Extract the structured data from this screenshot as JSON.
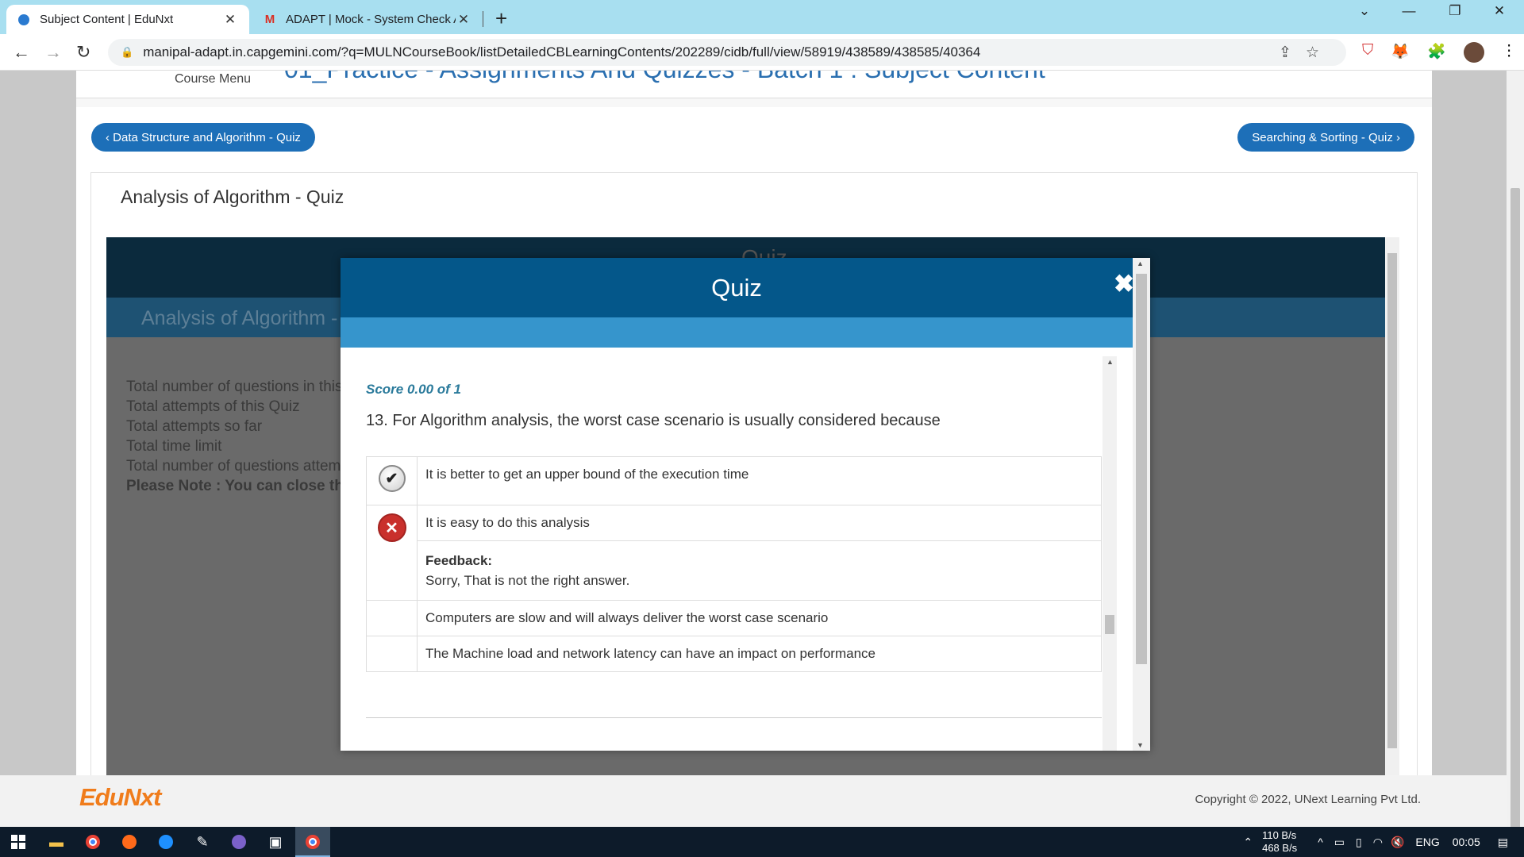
{
  "browser": {
    "tabs": [
      {
        "title": "Subject Content | EduNxt",
        "active": true
      },
      {
        "title": "ADAPT | Mock - System Check As",
        "active": false
      }
    ],
    "url": "manipal-adapt.in.capgemini.com/?q=MULNCourseBook/listDetailedCBLearningContents/202289/cidb/full/view/58919/438589/438585/40364"
  },
  "page": {
    "course_menu": "Course Menu",
    "partial_title": "01_Practice - Assignments And Quizzes - Batch 1 : Subject Content",
    "prev_button": "‹ Data Structure and Algorithm - Quiz",
    "next_button": "Searching & Sorting - Quiz ›",
    "card_title": "Analysis of Algorithm - Quiz",
    "frame": {
      "header_text": "Quiz",
      "subheader_text": "Analysis of Algorithm -",
      "info_lines": [
        "Total number of questions in this",
        "Total attempts of this Quiz",
        "Total attempts so far",
        "Total time limit",
        "Total number of questions attemp"
      ],
      "note": "Please Note : You can close th"
    },
    "footer": {
      "logo": "EduNxt",
      "copyright": "Copyright © 2022, UNext Learning Pvt Ltd."
    }
  },
  "modal": {
    "title": "Quiz",
    "close": "✖",
    "score": "Score 0.00 of 1",
    "question": "13. For Algorithm analysis, the worst case scenario is usually considered because",
    "options": [
      {
        "text": "It is better to get an upper bound of the execution time",
        "status": "correct"
      },
      {
        "text": "It is easy to do this analysis",
        "status": "wrong"
      },
      {
        "text": "Computers are slow and will always deliver the worst case scenario",
        "status": "none"
      },
      {
        "text": "The Machine load and network latency can have an impact on performance",
        "status": "none"
      }
    ],
    "feedback_label": "Feedback:",
    "feedback_text": "Sorry, That is not the right answer."
  },
  "taskbar": {
    "net_up": "110 B/s",
    "net_down": "468 B/s",
    "language": "ENG",
    "time": "00:05"
  }
}
